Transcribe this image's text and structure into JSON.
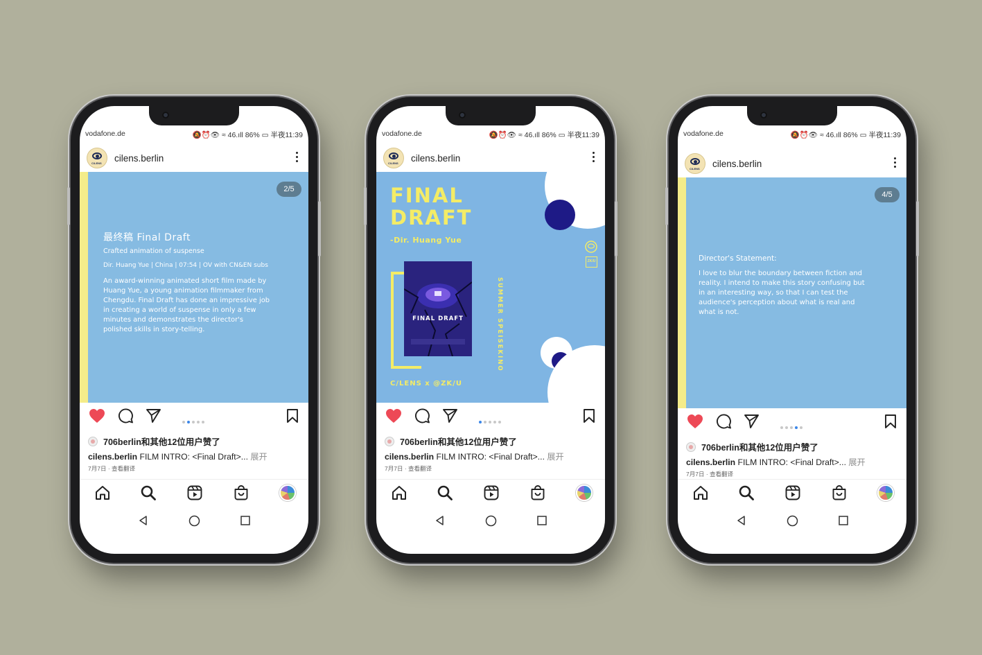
{
  "status_bar": {
    "carrier": "vodafone.de",
    "system": "🔕⏰👁 ≈ 46.ıll 86% ▭ 半夜11:39"
  },
  "post_header": {
    "username": "cilens.berlin"
  },
  "posts": [
    {
      "counter": "2/5",
      "title": "最终稿 Final Draft",
      "subtitle": "Crafted animation of suspense",
      "meta": "Dir. Huang Yue | China | 07:54 | OV with CN&EN subs",
      "body_lines": [
        "An award-winning animated short film made by",
        "Huang Yue, a young animation filmmaker from",
        "Chengdu. Final Draft has done an impressive job",
        "in creating a world of suspense in only a few",
        "minutes and demonstrates the director's",
        "polished skills in story-telling."
      ]
    },
    {
      "poster_title_1": "FINAL",
      "poster_title_2": "DRAFT",
      "poster_director": "-Dir. Huang Yue",
      "poster_inner_title": "FINAL DRAFT",
      "poster_side": "SUMMER SPEISEKINO",
      "poster_footer": "C/LENS x @ZK/U",
      "logo_text": "C/LENS",
      "logo_text_2": "ZK/U"
    },
    {
      "counter": "4/5",
      "heading": "Director's Statement:",
      "body_lines": [
        "I love to blur the boundary between fiction and",
        "reality. I intend to make this story confusing but",
        "in an interesting way, so that I can test the",
        "audience's perception about what is real and",
        "what is not."
      ]
    }
  ],
  "feed": {
    "likes_text": "706berlin和其他12位用户赞了",
    "caption_user": "cilens.berlin",
    "caption_text": " FILM INTRO: <Final Draft>...",
    "caption_more": " 展开",
    "date": "7月7日 · 查看翻译"
  },
  "colors": {
    "post_bg": "#86bbe2",
    "stripe": "#f4ec8a",
    "like_red": "#ed4956",
    "active_dot": "#3b86e8",
    "poster_navy": "#1e1a86"
  },
  "icons": [
    "heart-icon",
    "comment-icon",
    "share-icon",
    "bookmark-icon",
    "home-icon",
    "search-icon",
    "reels-icon",
    "shop-icon",
    "back-icon",
    "home-circle-icon",
    "recents-icon",
    "more-icon"
  ]
}
